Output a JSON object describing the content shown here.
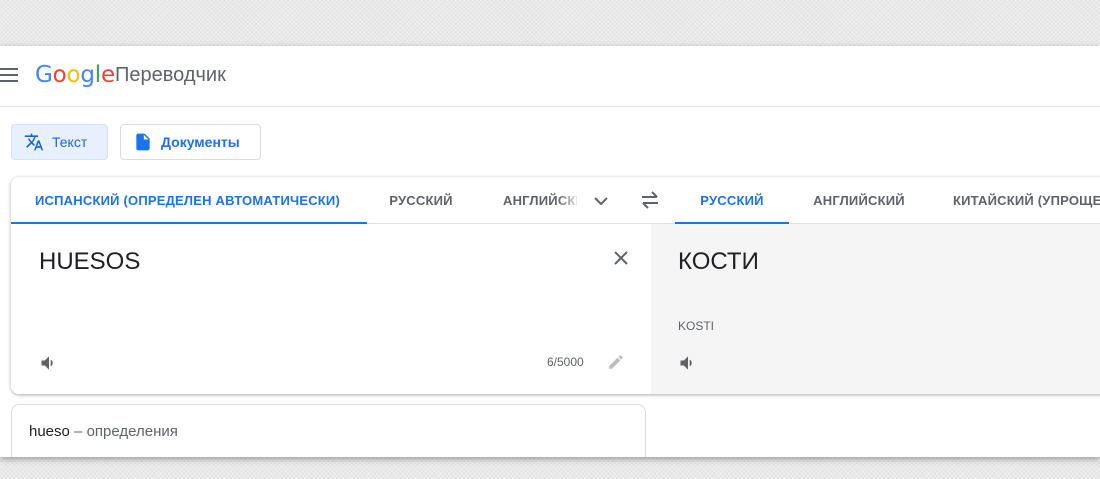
{
  "header": {
    "logo": {
      "g1": "G",
      "o1": "o",
      "o2": "o",
      "g2": "g",
      "l": "l",
      "e": "e"
    },
    "product": "Переводчик"
  },
  "modes": {
    "text_label": "Текст",
    "docs_label": "Документы"
  },
  "source_langs": [
    "ИСПАНСКИЙ (ОПРЕДЕЛЕН АВТОМАТИЧЕСКИ)",
    "РУССКИЙ",
    "АНГЛИЙСКИЙ"
  ],
  "target_langs": [
    "РУССКИЙ",
    "АНГЛИЙСКИЙ",
    "КИТАЙСКИЙ (УПРОЩЕННЫЙ)"
  ],
  "source": {
    "text": "HUESOS",
    "char_count": "6/5000"
  },
  "target": {
    "text": "КОСТИ",
    "transliteration": "KOSTI"
  },
  "definitions": {
    "word": "hueso",
    "separator": " – ",
    "label": "определения"
  },
  "colors": {
    "accent": "#1a73e8",
    "target_pane_bg": "#f5f5f5"
  },
  "icons": [
    "menu-icon",
    "translate-icon",
    "document-icon",
    "chevron-down-icon",
    "swap-icon",
    "close-icon",
    "speaker-icon",
    "pencil-icon"
  ]
}
